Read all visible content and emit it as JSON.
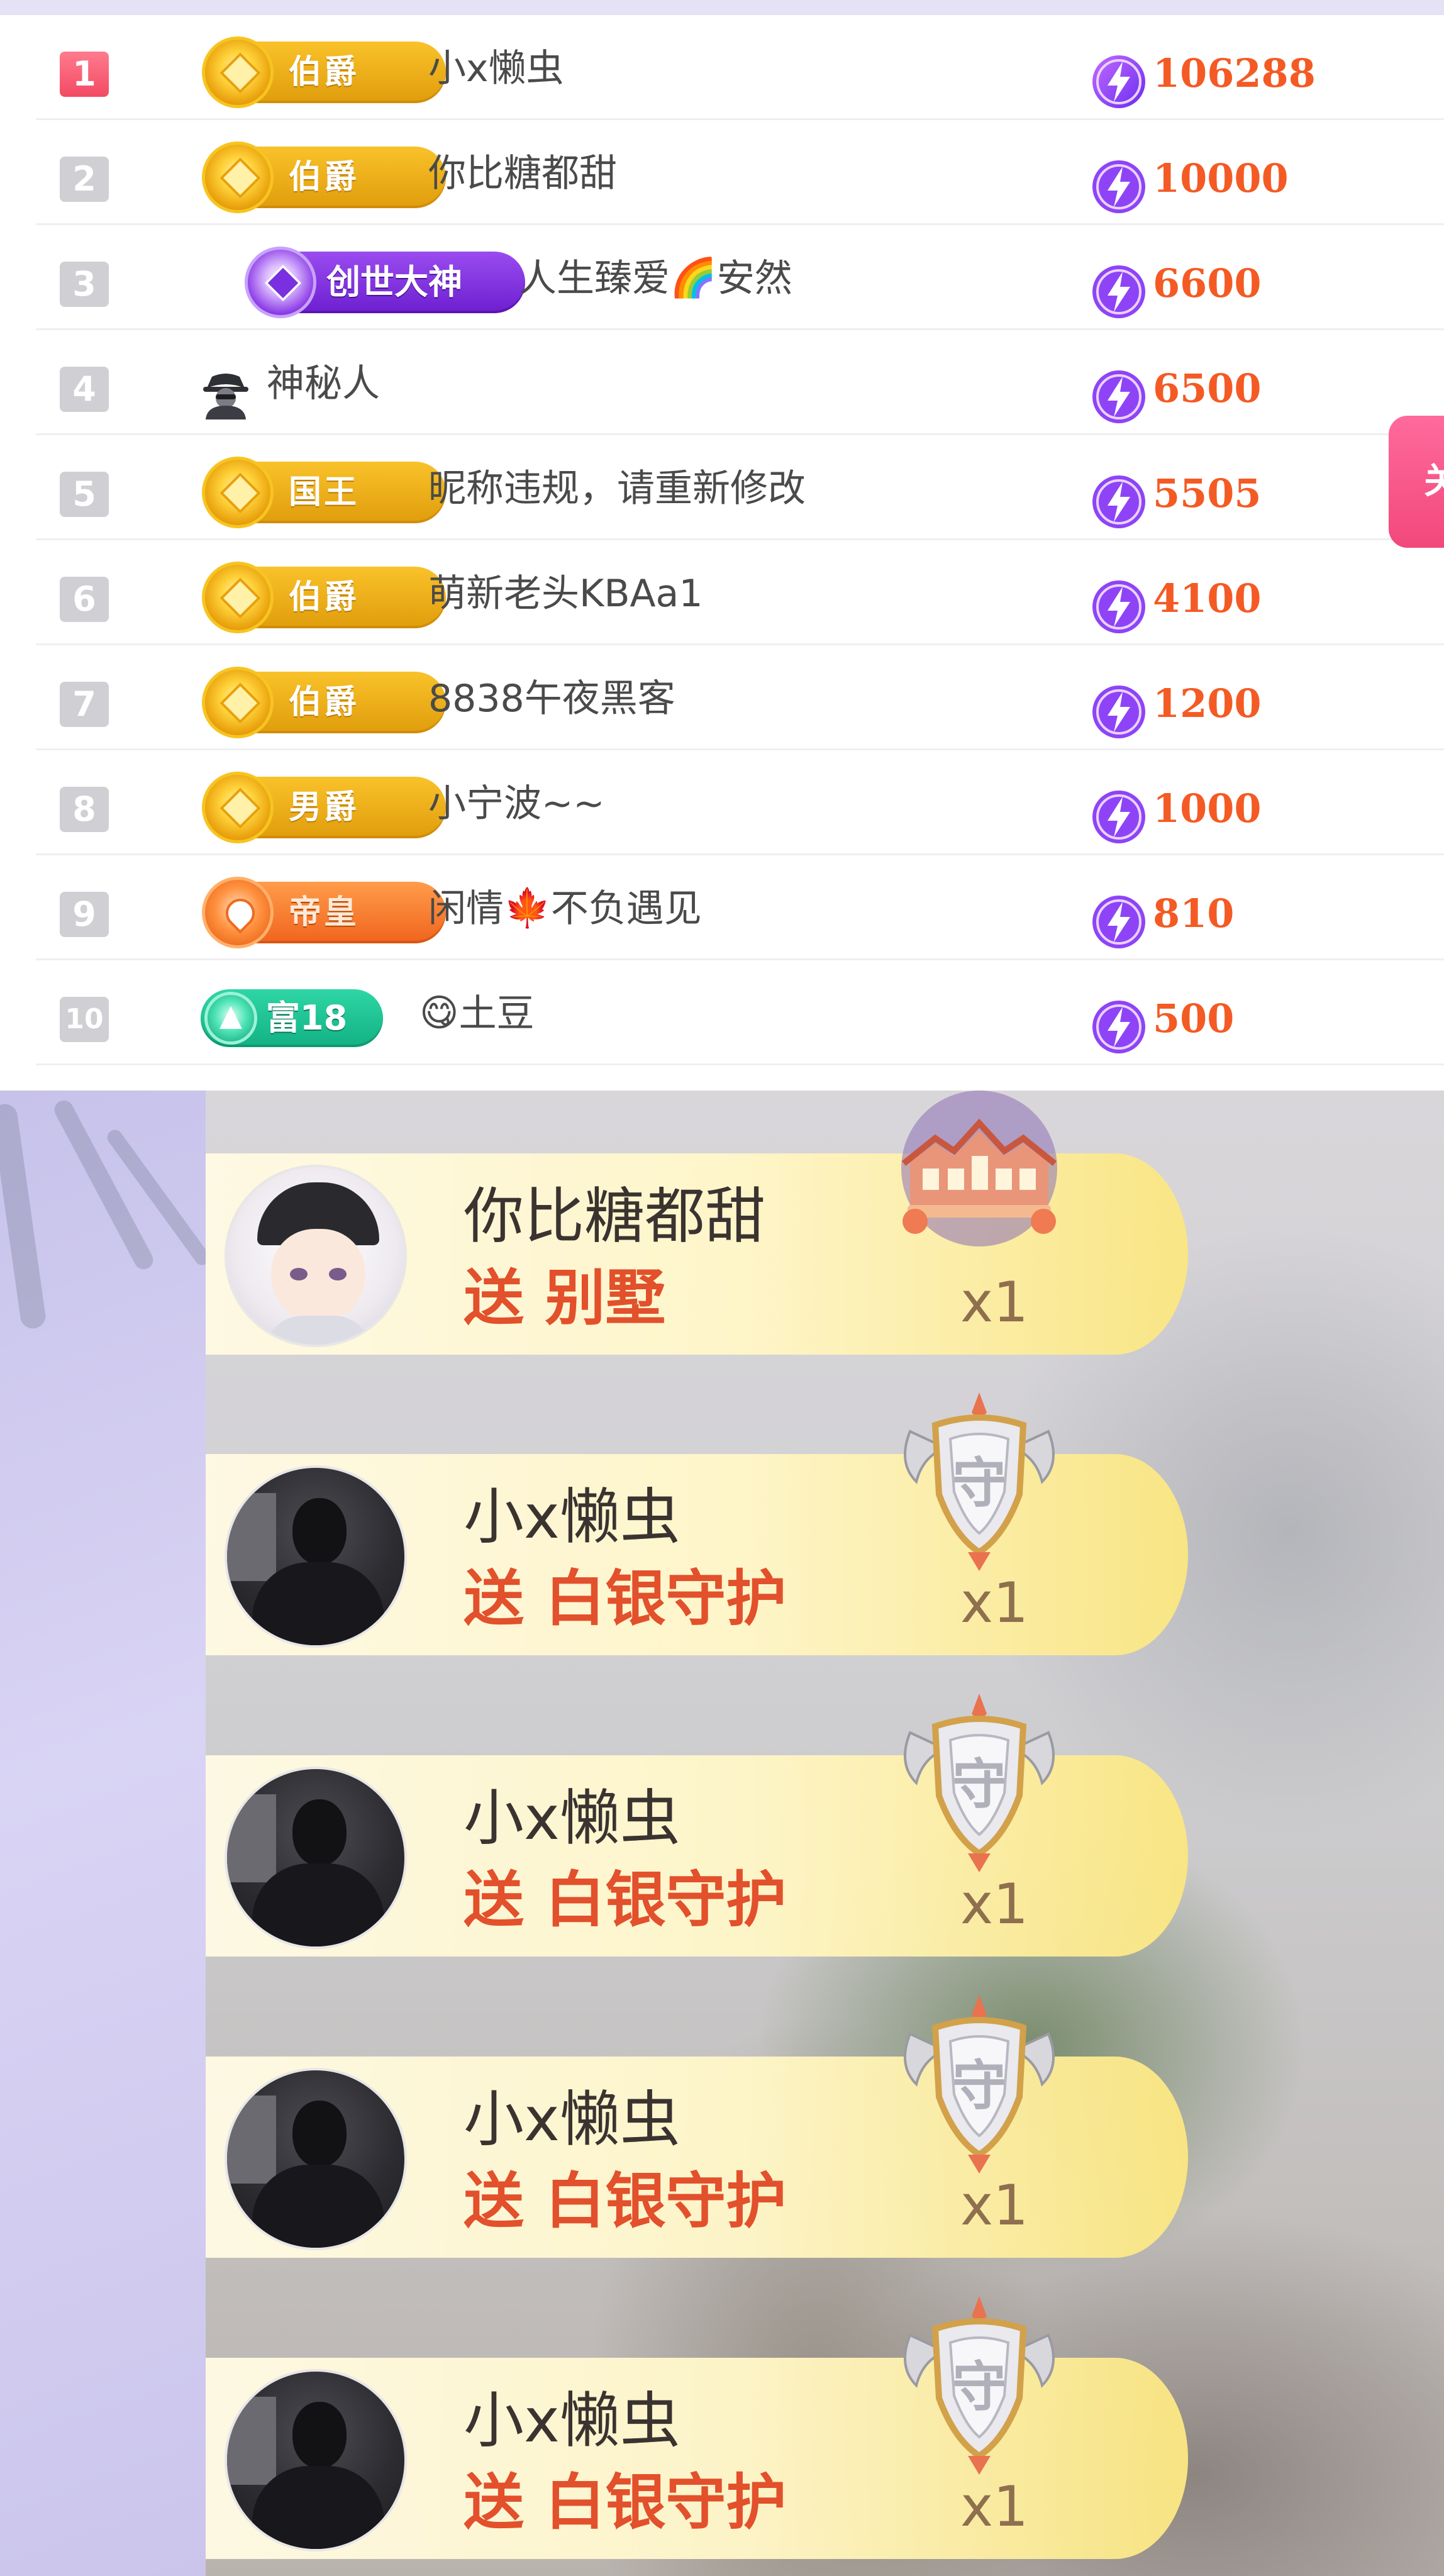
{
  "leaderboard": {
    "rows": [
      {
        "rank": "1",
        "badge": "伯爵",
        "badge_style": "gold",
        "name": "小x懒虫",
        "score": "106288"
      },
      {
        "rank": "2",
        "badge": "伯爵",
        "badge_style": "gold",
        "name": "你比糖都甜",
        "score": "10000"
      },
      {
        "rank": "3",
        "badge": "创世大神",
        "badge_style": "purple",
        "name": "人生臻爱",
        "name_emoji": "🌈",
        "name_suffix": "安然",
        "score": "6600"
      },
      {
        "rank": "4",
        "badge": "",
        "badge_style": "mystery",
        "name": "神秘人",
        "score": "6500"
      },
      {
        "rank": "5",
        "badge": "国王",
        "badge_style": "gold",
        "name": "昵称违规，请重新修改",
        "score": "5505"
      },
      {
        "rank": "6",
        "badge": "伯爵",
        "badge_style": "gold",
        "name": "萌新老头KBAa1",
        "score": "4100"
      },
      {
        "rank": "7",
        "badge": "伯爵",
        "badge_style": "gold",
        "name": "8838午夜黑客",
        "score": "1200"
      },
      {
        "rank": "8",
        "badge": "男爵",
        "badge_style": "gold",
        "name": "小宁波~~",
        "score": "1000"
      },
      {
        "rank": "9",
        "badge": "帝皇",
        "badge_style": "orange",
        "name": "闲情",
        "name_emoji": "🍁",
        "name_suffix": "不负遇见",
        "score": "810"
      },
      {
        "rank": "10",
        "badge": "富18",
        "badge_style": "green",
        "name_emoji": "😋",
        "name": "土豆",
        "score": "500"
      }
    ],
    "side_button": "关"
  },
  "gift_feed": [
    {
      "user": "你比糖都甜",
      "action": "送 别墅",
      "count": "x1",
      "gift_icon": "villa-icon",
      "avatar": "cartoon"
    },
    {
      "user": "小x懒虫",
      "action": "送 白银守护",
      "count": "x1",
      "gift_icon": "silver-guard-shield-icon",
      "avatar": "photo"
    },
    {
      "user": "小x懒虫",
      "action": "送 白银守护",
      "count": "x1",
      "gift_icon": "silver-guard-shield-icon",
      "avatar": "photo"
    },
    {
      "user": "小x懒虫",
      "action": "送 白银守护",
      "count": "x1",
      "gift_icon": "silver-guard-shield-icon",
      "avatar": "photo"
    },
    {
      "user": "小x懒虫",
      "action": "送 白银守护",
      "count": "x1",
      "gift_icon": "silver-guard-shield-icon",
      "avatar": "photo"
    }
  ],
  "shield_glyph": "守",
  "colors": {
    "score": "#f45a24",
    "gift_action": "#e2502c",
    "rank_first": "#f24a63"
  }
}
